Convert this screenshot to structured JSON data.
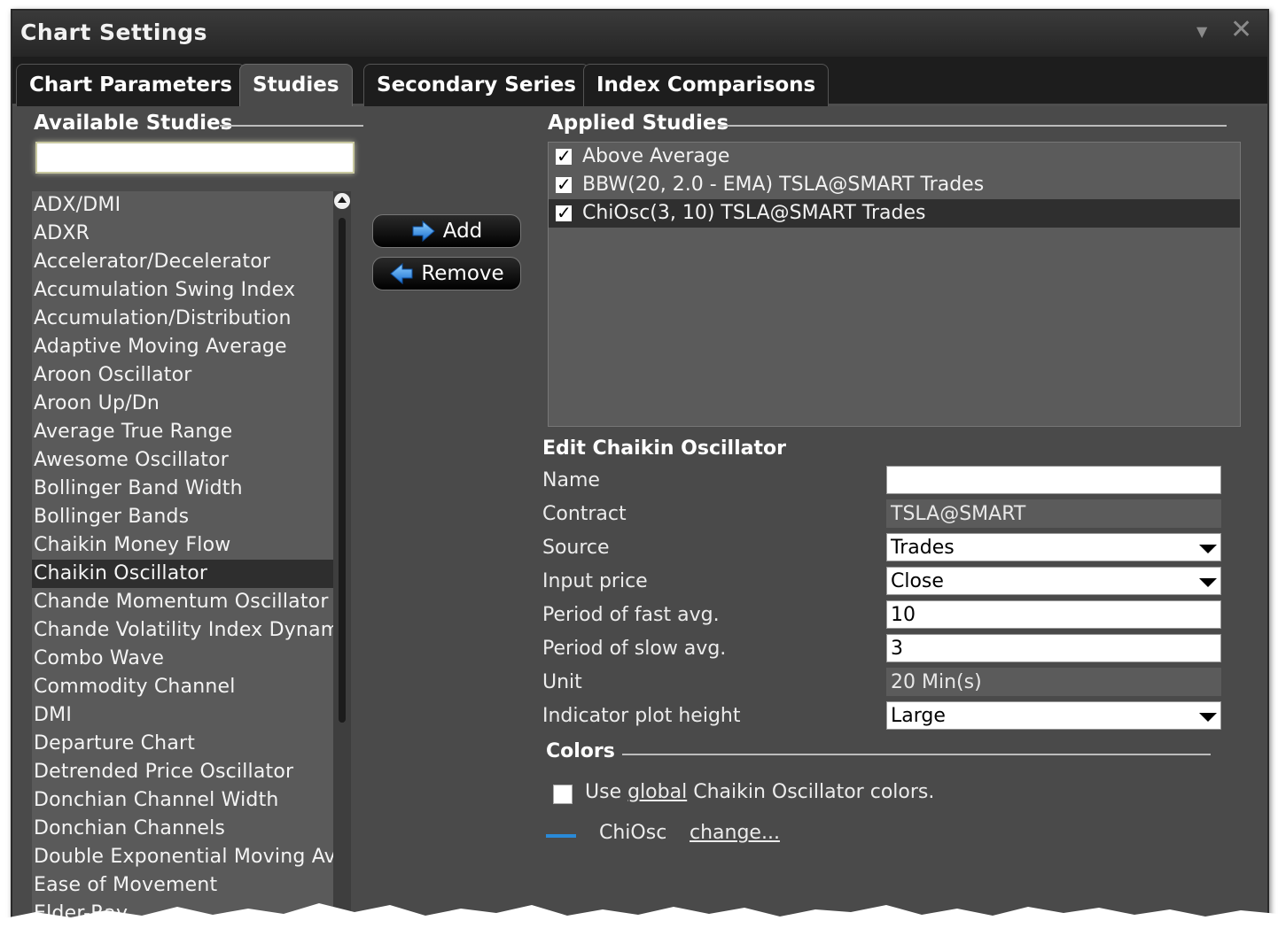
{
  "window": {
    "title": "Chart Settings"
  },
  "tabs": [
    {
      "label": "Chart Parameters"
    },
    {
      "label": "Studies"
    },
    {
      "label": "Secondary Series"
    },
    {
      "label": "Index Comparisons"
    }
  ],
  "available": {
    "heading": "Available Studies",
    "search_value": "",
    "items": [
      "ADX/DMI",
      "ADXR",
      "Accelerator/Decelerator",
      "Accumulation Swing Index",
      "Accumulation/Distribution",
      "Adaptive Moving Average",
      "Aroon Oscillator",
      "Aroon Up/Dn",
      "Average True Range",
      "Awesome Oscillator",
      "Bollinger Band Width",
      "Bollinger Bands",
      "Chaikin Money Flow",
      "Chaikin Oscillator",
      "Chande Momentum Oscillator",
      "Chande Volatility Index Dynami",
      "Combo Wave",
      "Commodity Channel",
      "DMI",
      "Departure Chart",
      "Detrended Price Oscillator",
      "Donchian Channel Width",
      "Donchian Channels",
      "Double Exponential Moving Avg",
      "Ease of Movement",
      "Elder-Ray"
    ],
    "selected_index": 13
  },
  "buttons": {
    "add": "Add",
    "remove": "Remove"
  },
  "applied": {
    "heading": "Applied Studies",
    "items": [
      {
        "label": "Above Average",
        "checked": true
      },
      {
        "label": "BBW(20, 2.0 - EMA) TSLA@SMART Trades",
        "checked": true
      },
      {
        "label": "ChiOsc(3, 10) TSLA@SMART Trades",
        "checked": true
      }
    ],
    "selected_index": 2
  },
  "edit": {
    "title": "Edit Chaikin Oscillator",
    "fields": {
      "name": {
        "label": "Name",
        "value": ""
      },
      "contract": {
        "label": "Contract",
        "value": "TSLA@SMART"
      },
      "source": {
        "label": "Source",
        "value": "Trades"
      },
      "input_price": {
        "label": "Input price",
        "value": "Close"
      },
      "fast_avg": {
        "label": "Period of fast avg.",
        "value": "10"
      },
      "slow_avg": {
        "label": "Period of slow avg.",
        "value": "3"
      },
      "unit": {
        "label": "Unit",
        "value": "20 Min(s)"
      },
      "plot_height": {
        "label": "Indicator plot height",
        "value": "Large"
      }
    }
  },
  "colors": {
    "heading": "Colors",
    "use_prefix": "Use",
    "use_link": "global",
    "use_suffix": "Chaikin Oscillator colors.",
    "use_checked": false,
    "series_name": "ChiOsc",
    "change_link": "change...",
    "series_color": "#2a8ad8"
  }
}
